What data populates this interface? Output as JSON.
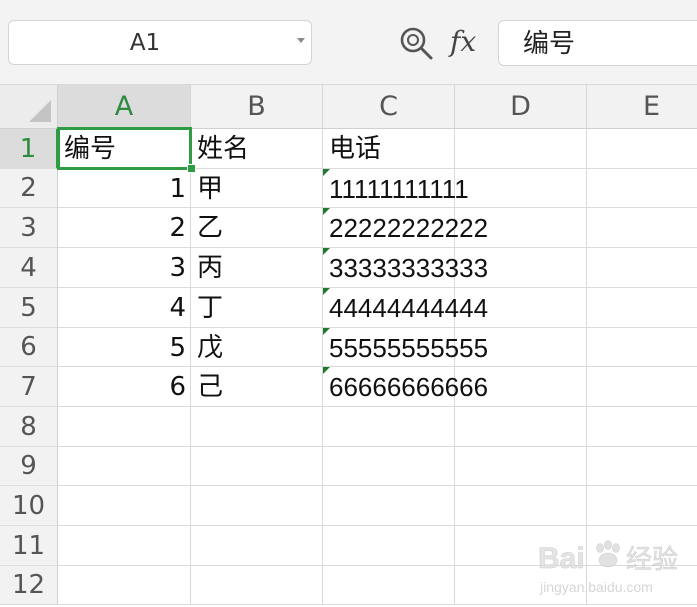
{
  "formula_bar": {
    "name_box_value": "A1",
    "formula_icon_label": "fx",
    "formula_value": "编号"
  },
  "columns": [
    "A",
    "B",
    "C",
    "D",
    "E"
  ],
  "rows": [
    "1",
    "2",
    "3",
    "4",
    "5",
    "6",
    "7",
    "8",
    "9",
    "10",
    "11",
    "12"
  ],
  "cells": {
    "header": [
      "编号",
      "姓名",
      "电话"
    ],
    "data": [
      {
        "id": "1",
        "name": "甲",
        "phone": "11111111111"
      },
      {
        "id": "2",
        "name": "乙",
        "phone": "22222222222"
      },
      {
        "id": "3",
        "name": "丙",
        "phone": "33333333333"
      },
      {
        "id": "4",
        "name": "丁",
        "phone": "44444444444"
      },
      {
        "id": "5",
        "name": "戊",
        "phone": "55555555555"
      },
      {
        "id": "6",
        "name": "己",
        "phone": "66666666666"
      }
    ]
  },
  "selection": {
    "active_cell": "A1"
  },
  "colors": {
    "accent": "#2e9c43",
    "text_flag": "#1d7a2d"
  },
  "watermark": {
    "brand": "Baidu",
    "brand_cn": "经验",
    "url": "jingyan.baidu.com"
  }
}
